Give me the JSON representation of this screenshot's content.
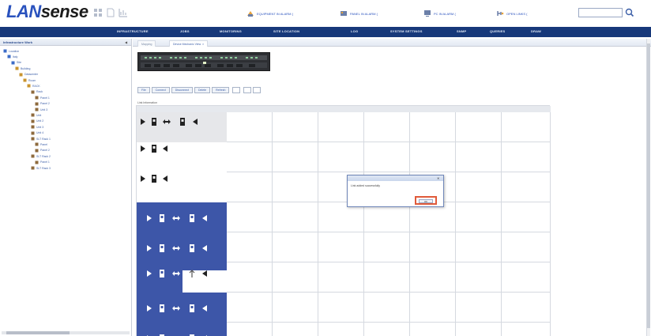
{
  "logo": {
    "part1": "LAN",
    "part2": "sense"
  },
  "header": {
    "alarms": [
      {
        "label": "EQUIPMENT IN ALARM (",
        "icon": "equipment-alarm-icon"
      },
      {
        "label": "PANEL IN ALARM (",
        "icon": "panel-alarm-icon"
      },
      {
        "label": "PC IN ALARM (",
        "icon": "pc-alarm-icon"
      },
      {
        "label": "OPEN LINKS (",
        "icon": "open-links-icon"
      }
    ],
    "search": {
      "placeholder": ""
    }
  },
  "menu": [
    "INFRASTRUCTURE",
    "JOBS",
    "MONITORING",
    "SITE LOCATION",
    "LOG",
    "SYSTEM SETTINGS",
    "SNMP",
    "QUERIES",
    "DRAW"
  ],
  "left": {
    "title": "Infrastructure Work",
    "tree": [
      {
        "label": "Location",
        "indent": 0
      },
      {
        "label": "Italy",
        "indent": 1
      },
      {
        "label": "Site",
        "indent": 2
      },
      {
        "label": "Building",
        "indent": 3
      },
      {
        "label": "Datacenter",
        "indent": 4
      },
      {
        "label": "Room",
        "indent": 5
      },
      {
        "label": "RACK",
        "indent": 6
      },
      {
        "label": "Rack",
        "indent": 7
      },
      {
        "label": "Panel 1",
        "indent": 8
      },
      {
        "label": "Panel 2",
        "indent": 8
      },
      {
        "label": "Unit 3",
        "indent": 8
      },
      {
        "label": "Unit",
        "indent": 7
      },
      {
        "label": "Unit 2",
        "indent": 7
      },
      {
        "label": "Unit 3",
        "indent": 7
      },
      {
        "label": "Unit 4",
        "indent": 7
      },
      {
        "label": "SLT Rack 1",
        "indent": 7
      },
      {
        "label": "Panel",
        "indent": 8
      },
      {
        "label": "Panel 2",
        "indent": 8
      },
      {
        "label": "SLT Rack 2",
        "indent": 7
      },
      {
        "label": "Panel 1",
        "indent": 8
      },
      {
        "label": "SLT Rack 3",
        "indent": 7
      }
    ]
  },
  "tabs": [
    {
      "label": "Mapping"
    },
    {
      "label": "Device Mechanic View"
    }
  ],
  "rack_caption": "",
  "toolbar": {
    "buttons": [
      "File",
      "Connect",
      "Disconnect",
      "Delete",
      "Refresh"
    ],
    "count_prefix": "",
    "count_suffix": ""
  },
  "section_label": "Link Information",
  "ports": [
    {
      "style": "grey",
      "type": "double",
      "left_label": "",
      "right_label": ""
    },
    {
      "style": "white",
      "type": "single",
      "left_label": ""
    },
    {
      "style": "white",
      "type": "single",
      "left_label": ""
    },
    {
      "style": "blue",
      "type": "double-blue"
    },
    {
      "style": "blue",
      "type": "double-blue"
    },
    {
      "style": "blue",
      "type": "mixed",
      "right_label": ""
    },
    {
      "style": "blue",
      "type": "double-blue"
    },
    {
      "style": "blue",
      "type": "double-blue"
    }
  ],
  "dialog": {
    "title": "",
    "message": "Link added successfully",
    "ok_label": "OK"
  },
  "colors": {
    "menubar": "#17387a",
    "blue_cell": "#3d56a8",
    "accent": "#2a52be",
    "ok_highlight": "#e05a3a"
  }
}
